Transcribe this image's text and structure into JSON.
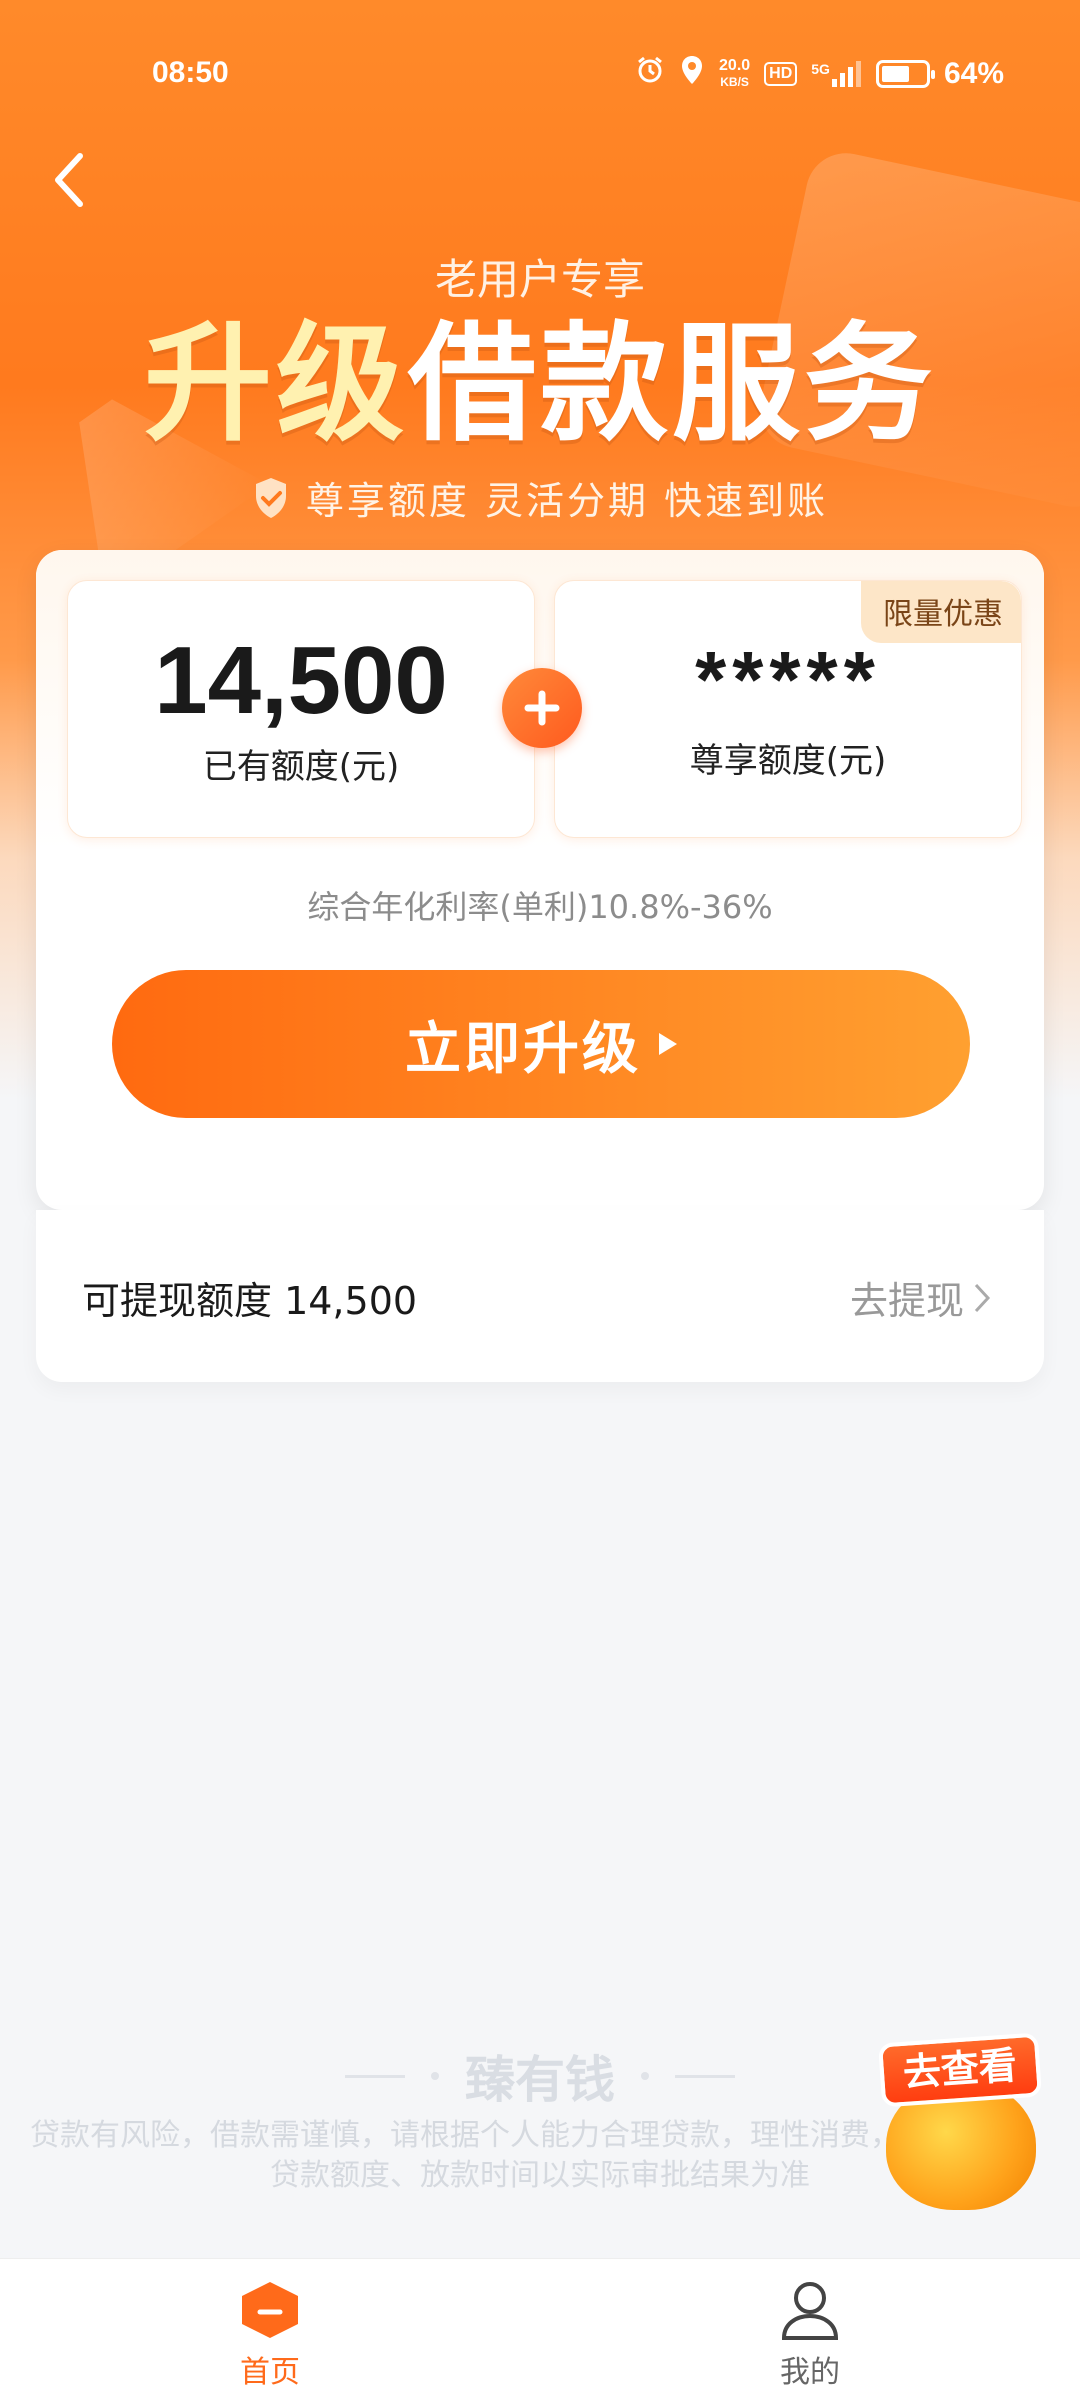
{
  "status_bar": {
    "time": "08:50",
    "net_speed_value": "20.0",
    "net_speed_unit": "KB/S",
    "hd": "HD",
    "signal": "5G",
    "battery": "64%",
    "battery_level": 0.64
  },
  "header": {
    "subtitle": "老用户专享",
    "title_part1": "升级",
    "title_part2": "借款服务",
    "tagline": "尊享额度 灵活分期 快速到账"
  },
  "quota_card": {
    "existing_amount": "14,500",
    "existing_label": "已有额度(元)",
    "exclusive_amount": "*****",
    "exclusive_label": "尊享额度(元)",
    "badge": "限量优惠",
    "rate_text": "综合年化利率(单利)10.8%-36%",
    "upgrade_button": "立即升级"
  },
  "withdraw": {
    "label": "可提现额度 14,500",
    "action": "去提现"
  },
  "footer": {
    "brand": "臻有钱",
    "disclaimer": "贷款有风险，借款需谨慎，请根据个人能力合理贷款，理性消费，避免逾期。贷款额度、放款时间以实际审批结果为准",
    "promo_label": "去查看"
  },
  "tabbar": {
    "home": "首页",
    "mine": "我的"
  },
  "colors": {
    "accent": "#ff6a1a",
    "hero": "#ff7a1e"
  }
}
